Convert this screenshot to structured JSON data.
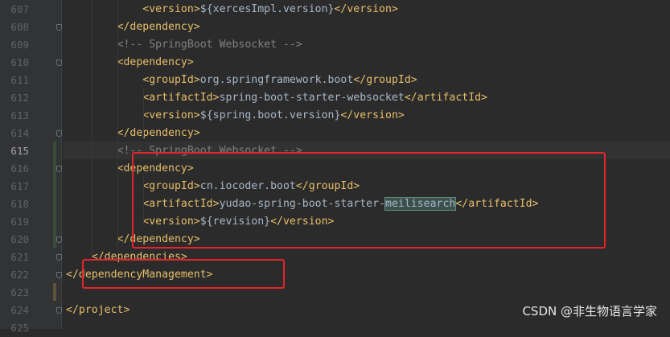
{
  "editor": {
    "lines": [
      {
        "num": "607",
        "indent": "            ",
        "parts": [
          {
            "text": "<version>",
            "k": "t"
          },
          {
            "text": "${xercesImpl.version}",
            "k": "x"
          },
          {
            "text": "</version>",
            "k": "t"
          }
        ]
      },
      {
        "num": "608",
        "indent": "        ",
        "parts": [
          {
            "text": "</dependency>",
            "k": "t"
          }
        ]
      },
      {
        "num": "609",
        "indent": "        ",
        "parts": [
          {
            "text": "<!-- SpringBoot Websocket -->",
            "k": "c"
          }
        ]
      },
      {
        "num": "610",
        "indent": "        ",
        "parts": [
          {
            "text": "<dependency>",
            "k": "t"
          }
        ]
      },
      {
        "num": "611",
        "indent": "            ",
        "parts": [
          {
            "text": "<groupId>",
            "k": "t"
          },
          {
            "text": "org.springframework.boot",
            "k": "x"
          },
          {
            "text": "</groupId>",
            "k": "t"
          }
        ]
      },
      {
        "num": "612",
        "indent": "            ",
        "parts": [
          {
            "text": "<artifactId>",
            "k": "t"
          },
          {
            "text": "spring-boot-starter-websocket",
            "k": "x"
          },
          {
            "text": "</artifactId>",
            "k": "t"
          }
        ]
      },
      {
        "num": "613",
        "indent": "            ",
        "parts": [
          {
            "text": "<version>",
            "k": "t"
          },
          {
            "text": "${spring.boot.version}",
            "k": "x"
          },
          {
            "text": "</version>",
            "k": "t"
          }
        ]
      },
      {
        "num": "614",
        "indent": "        ",
        "parts": [
          {
            "text": "</dependency>",
            "k": "t"
          }
        ]
      },
      {
        "num": "615",
        "indent": "        ",
        "current": true,
        "parts": [
          {
            "text": "<!-- SpringBoot Websocket -->",
            "k": "c"
          }
        ]
      },
      {
        "num": "616",
        "indent": "        ",
        "parts": [
          {
            "text": "<dependency>",
            "k": "t"
          }
        ]
      },
      {
        "num": "617",
        "indent": "            ",
        "parts": [
          {
            "text": "<groupId>",
            "k": "t"
          },
          {
            "text": "cn.iocoder.boot",
            "k": "x"
          },
          {
            "text": "</groupId>",
            "k": "t"
          }
        ]
      },
      {
        "num": "618",
        "indent": "            ",
        "parts": [
          {
            "text": "<artifactId>",
            "k": "t"
          },
          {
            "text": "yudao-spring-boot-starter-",
            "k": "x"
          },
          {
            "text": "meilisearch",
            "k": "x",
            "hl": true
          },
          {
            "text": "</artifactId>",
            "k": "t"
          }
        ]
      },
      {
        "num": "619",
        "indent": "            ",
        "parts": [
          {
            "text": "<version>",
            "k": "t"
          },
          {
            "text": "${revision}",
            "k": "x"
          },
          {
            "text": "</version>",
            "k": "t"
          }
        ]
      },
      {
        "num": "620",
        "indent": "        ",
        "parts": [
          {
            "text": "</dependency>",
            "k": "t"
          }
        ]
      },
      {
        "num": "621",
        "indent": "    ",
        "parts": [
          {
            "text": "</dependencies>",
            "k": "t"
          }
        ]
      },
      {
        "num": "622",
        "indent": "",
        "parts": [
          {
            "text": "</dependencyManagement>",
            "k": "t"
          }
        ]
      },
      {
        "num": "623",
        "indent": "",
        "parts": []
      },
      {
        "num": "624",
        "indent": "",
        "parts": [
          {
            "text": "</project>",
            "k": "t"
          }
        ]
      },
      {
        "num": "625",
        "indent": "",
        "parts": []
      }
    ]
  },
  "watermark": "CSDN @非生物语言学家",
  "colors": {
    "background": "#2b2b2b",
    "tag": "#e8bf6a",
    "text": "#a9b7c6",
    "comment": "#808080",
    "annotation_box": "#e3242b"
  }
}
